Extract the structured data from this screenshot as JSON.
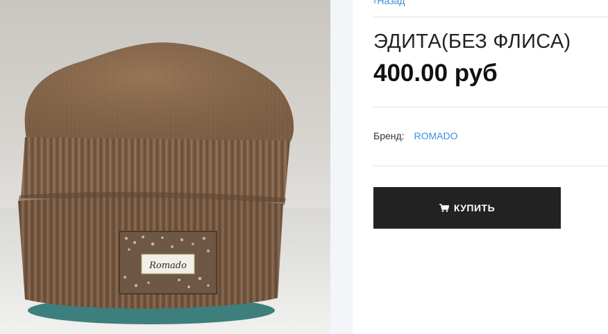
{
  "product_image": {
    "alt": "ЭДИТА(БЕЗ ФЛИСА)",
    "patch_text": "Romado"
  },
  "nav": {
    "back_label": "Назад"
  },
  "product": {
    "title": "ЭДИТА(БЕЗ ФЛИСА)",
    "price": "400.00 руб",
    "brand_label": "Бренд:",
    "brand_value": "ROMADO"
  },
  "actions": {
    "buy_label": "КУПИТЬ"
  },
  "colors": {
    "link": "#3a8fd8",
    "button_bg": "#222222",
    "hat_brown": "#8b6a4d"
  }
}
